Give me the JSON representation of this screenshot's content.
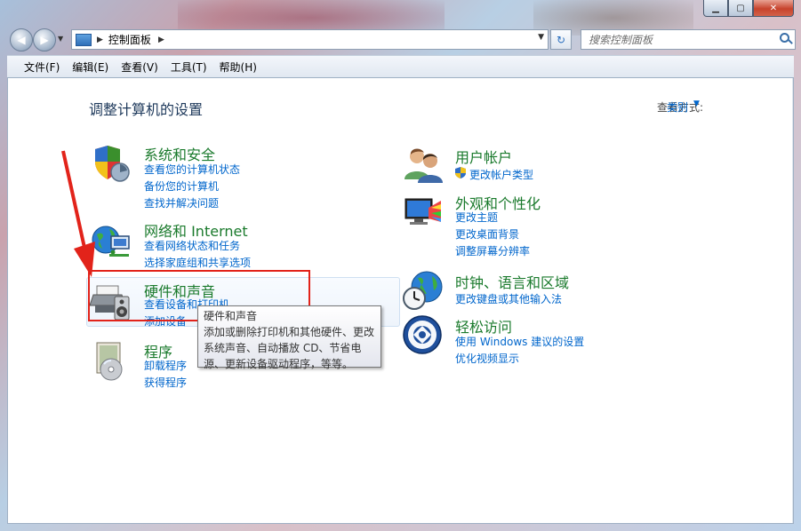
{
  "window": {
    "caption": {
      "minimize": "▁",
      "maximize": "▢",
      "close": "✕"
    }
  },
  "nav": {
    "back_icon": "◀",
    "forward_icon": "▶",
    "history_dropdown": "▼",
    "address": {
      "root_arrow": "▶",
      "crumb": "控制面板",
      "crumb_arrow": "▶",
      "dropdown": "▼"
    },
    "refresh_icon": "↻",
    "search_placeholder": "搜索控制面板"
  },
  "menubar": [
    "文件(F)",
    "编辑(E)",
    "查看(V)",
    "工具(T)",
    "帮助(H)"
  ],
  "main": {
    "title": "调整计算机的设置",
    "view_by_label": "查看方式:",
    "view_by_value": "类别",
    "view_by_arrow": "▼",
    "left": [
      {
        "title": "系统和安全",
        "links": [
          "查看您的计算机状态",
          "备份您的计算机",
          "查找并解决问题"
        ],
        "icon": "shield-icon"
      },
      {
        "title": "网络和 Internet",
        "links": [
          "查看网络状态和任务",
          "选择家庭组和共享选项"
        ],
        "icon": "network-icon"
      },
      {
        "title": "硬件和声音",
        "links": [
          "查看设备和打印机",
          "添加设备"
        ],
        "icon": "printer-icon"
      },
      {
        "title": "程序",
        "links": [
          "卸载程序",
          "获得程序"
        ],
        "icon": "programs-icon"
      }
    ],
    "right": [
      {
        "title": "用户帐户",
        "links": [
          "更改帐户类型"
        ],
        "icon": "users-icon"
      },
      {
        "title": "外观和个性化",
        "links": [
          "更改主题",
          "更改桌面背景",
          "调整屏幕分辨率"
        ],
        "icon": "appearance-icon"
      },
      {
        "title": "时钟、语言和区域",
        "links": [
          "更改键盘或其他输入法"
        ],
        "icon": "clock-globe-icon"
      },
      {
        "title": "轻松访问",
        "links": [
          "使用 Windows 建议的设置",
          "优化视频显示"
        ],
        "icon": "ease-of-access-icon"
      }
    ]
  },
  "tooltip": {
    "title": "硬件和声音",
    "lines": [
      "添加或删除打印机和其他硬件、更改",
      "系统声音、自动播放 CD、节省电",
      "源、更新设备驱动程序，等等。"
    ]
  },
  "colors": {
    "link": "#0066cc",
    "category_title": "#1a7a2c",
    "highlight_box": "#e2231a",
    "close_button": "#c7432c"
  }
}
